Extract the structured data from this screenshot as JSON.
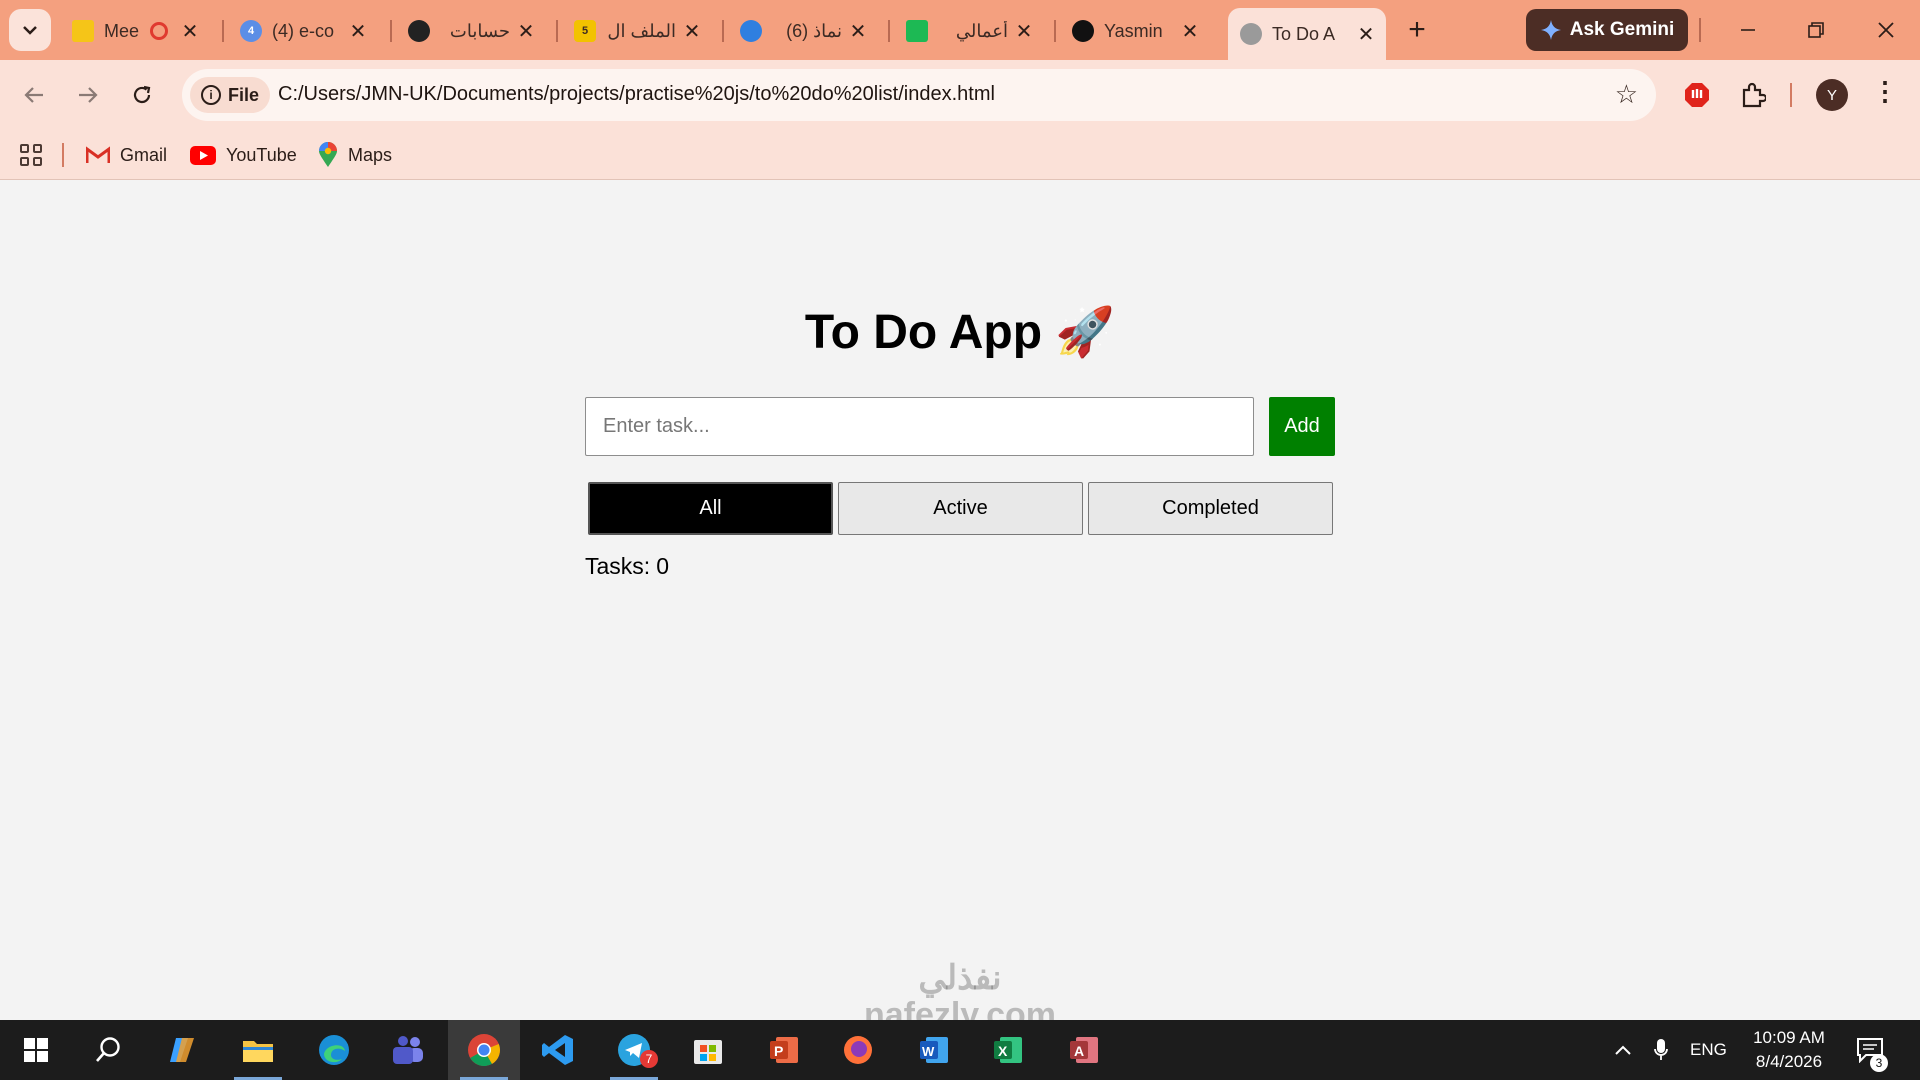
{
  "browser": {
    "tabs": [
      {
        "title": "Mee",
        "favicon": "yellow-doc-icon",
        "color": "#f5c518",
        "badge": ""
      },
      {
        "title": "(4) e-co",
        "favicon": "globe-icon",
        "color": "#5b8ee6",
        "badge": "4"
      },
      {
        "title": "حسابات",
        "favicon": "dot-icon",
        "color": "#222222",
        "badge": ""
      },
      {
        "title": "الملف ال",
        "favicon": "number-icon",
        "color": "#f2c200",
        "badge": "5"
      },
      {
        "title": "(6) نماذ",
        "favicon": "swirl-icon",
        "color": "#2f7fe0",
        "badge": ""
      },
      {
        "title": "أعمالي",
        "favicon": "k-logo-icon",
        "color": "#1db954",
        "badge": ""
      },
      {
        "title": "Yasmin",
        "favicon": "upwork-icon",
        "color": "#111111",
        "badge": ""
      },
      {
        "title": "To Do A",
        "favicon": "globe-icon",
        "color": "#9a9a9a",
        "badge": ""
      }
    ],
    "gemini_label": "Ask Gemini",
    "site_chip_label": "File",
    "url": "C:/Users/JMN-UK/Documents/projects/practise%20js/to%20do%20list/index.html",
    "avatar_letter": "Y",
    "bookmarks": [
      {
        "label": "Gmail",
        "icon": "gmail-icon"
      },
      {
        "label": "YouTube",
        "icon": "youtube-icon"
      },
      {
        "label": "Maps",
        "icon": "maps-icon"
      }
    ]
  },
  "app": {
    "title": "To Do App",
    "title_emoji": "🚀",
    "input_placeholder": "Enter task...",
    "input_value": "",
    "add_label": "Add",
    "filters": [
      {
        "label": "All",
        "selected": true
      },
      {
        "label": "Active",
        "selected": false
      },
      {
        "label": "Completed",
        "selected": false
      }
    ],
    "tasks_label": "Tasks:",
    "tasks_count": "0",
    "accent": "#008000"
  },
  "watermark": {
    "line1": "نفذلي",
    "line2": "nafezly.com"
  },
  "taskbar": {
    "language": "ENG",
    "time": "10:09 AM",
    "date": "8/4/2026",
    "notification_count": "3",
    "telegram_badge": "7"
  }
}
